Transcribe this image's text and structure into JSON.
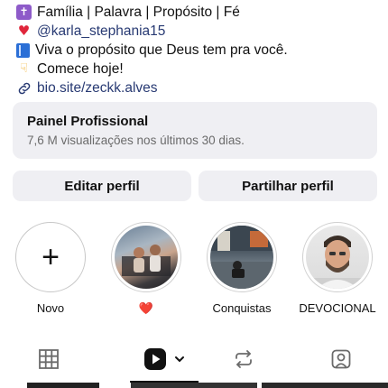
{
  "bio": {
    "line1": "Família | Palavra | Propósito | Fé",
    "line2_mention": "@karla_stephania15",
    "line3": "Viva o propósito que Deus tem pra você.",
    "line4": "Comece hoje!",
    "link": "bio.site/zeckk.alves"
  },
  "panel": {
    "title": "Painel Profissional",
    "subtitle": "7,6 M visualizações nos últimos 30 dias."
  },
  "buttons": {
    "edit": "Editar perfil",
    "share": "Partilhar perfil"
  },
  "highlights": [
    {
      "label": "Novo"
    },
    {
      "label": "❤️"
    },
    {
      "label": "Conquistas"
    },
    {
      "label": "DEVOCIONAL"
    }
  ],
  "icons": {
    "cross": "latin-cross-icon",
    "heart": "red-heart-icon",
    "book": "blue-book-icon",
    "hand": "pointing-down-icon",
    "link": "link-icon",
    "grid": "grid-icon",
    "reels": "reels-icon",
    "reposts": "repost-icon",
    "tagged": "tagged-icon"
  },
  "colors": {
    "link": "#283a73",
    "panel_bg": "#efeff3",
    "text": "#111111",
    "muted": "#6b6b6b"
  }
}
